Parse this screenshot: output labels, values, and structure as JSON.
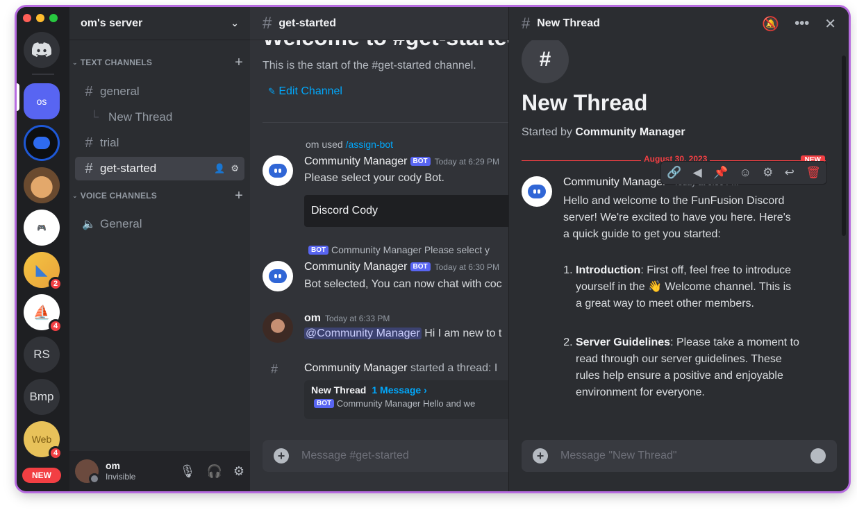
{
  "rail": {
    "servers": [
      {
        "label": ""
      },
      {
        "label": "os"
      },
      {
        "label": ""
      },
      {
        "label": ""
      },
      {
        "label": ""
      },
      {
        "label": "",
        "badge": "2"
      },
      {
        "label": "",
        "badge": "4"
      },
      {
        "label": "RS"
      },
      {
        "label": "Bmp"
      },
      {
        "label": "Web",
        "badge": "4"
      }
    ],
    "new_pill": "NEW"
  },
  "sidebar": {
    "server_name": "om's server",
    "text_category": "TEXT CHANNELS",
    "voice_category": "VOICE CHANNELS",
    "channels": [
      {
        "name": "general"
      },
      {
        "name": "New Thread"
      },
      {
        "name": "trial"
      },
      {
        "name": "get-started"
      }
    ],
    "voice_channels": [
      {
        "name": "General"
      }
    ],
    "user": {
      "name": "om",
      "status": "Invisible"
    }
  },
  "main": {
    "channel": "get-started",
    "welcome": "Welcome to #get-started!",
    "start_text": "This is the start of the #get-started channel.",
    "edit_channel": "Edit Channel",
    "messages": [
      {
        "ref_user": "om used",
        "ref_cmd": "/assign-bot",
        "author": "Community Manager",
        "bot": "BOT",
        "time": "Today at 6:29 PM",
        "text": "Please select your cody Bot.",
        "select": "Discord Cody"
      },
      {
        "ref_bot": "BOT",
        "ref_user": "Community Manager",
        "ref_text": "Please select y",
        "author": "Community Manager",
        "bot": "BOT",
        "time": "Today at 6:30 PM",
        "text": "Bot selected, You can now chat with coc"
      },
      {
        "author": "om",
        "time": "Today at 6:33 PM",
        "mention": "@Community Manager",
        "text": "Hi I am new to t"
      }
    ],
    "thread_notice": {
      "author": "Community Manager",
      "text": "started a thread: I",
      "card_title": "New Thread",
      "card_count": "1 Message ›",
      "card_bot": "BOT",
      "card_author": "Community Manager",
      "card_preview": "Hello and we"
    },
    "input_placeholder": "Message #get-started"
  },
  "thread": {
    "title": "New Thread",
    "started_by_label": "Started by",
    "started_by": "Community Manager",
    "date": "August 30, 2023",
    "new_tag": "NEW",
    "author": "Community Manager",
    "time": "Today at 6:36 PM",
    "intro": "Hello and welcome to the FunFusion Discord server! We're excited to have you here. Here's a quick guide to get you started:",
    "items": [
      {
        "title": "Introduction",
        "text": ": First off, feel free to introduce yourself in the 👋 Welcome channel. This is a great way to meet other members."
      },
      {
        "title": "Server Guidelines",
        "text": ": Please take a moment to read through our server guidelines. These rules help ensure a positive and enjoyable environment for everyone."
      }
    ],
    "input_placeholder": "Message \"New Thread\""
  },
  "colors": {
    "accent": "#5865f2",
    "danger": "#f23f43",
    "link": "#00a8fc"
  }
}
